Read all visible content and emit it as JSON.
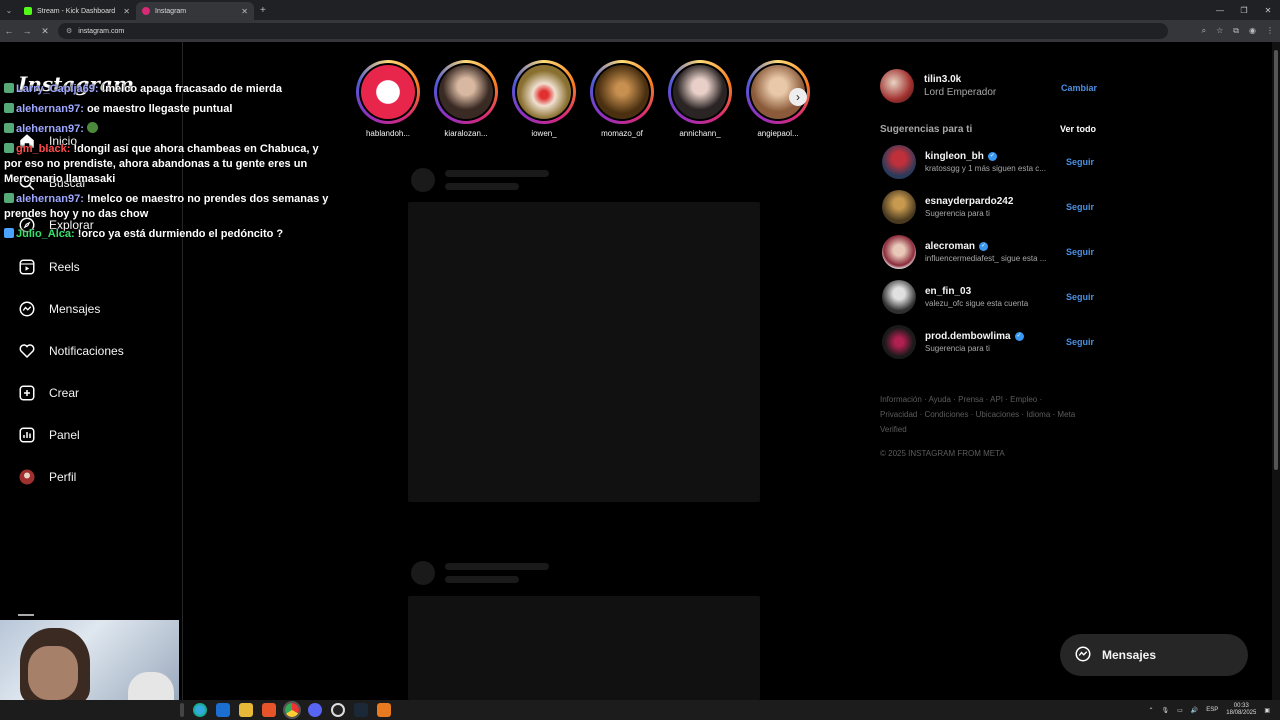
{
  "browser": {
    "tabs": [
      {
        "title": "Stream - Kick Dashboard",
        "favicon_color": "#53fc18"
      },
      {
        "title": "Instagram",
        "favicon_color": "#d62976"
      }
    ],
    "url": "instagram.com"
  },
  "sidebar": {
    "logo": "Instagram",
    "items": [
      {
        "label": "Inicio",
        "icon": "home-icon"
      },
      {
        "label": "Buscar",
        "icon": "search-icon"
      },
      {
        "label": "Explorar",
        "icon": "compass-icon"
      },
      {
        "label": "Reels",
        "icon": "reels-icon"
      },
      {
        "label": "Mensajes",
        "icon": "messenger-icon"
      },
      {
        "label": "Notificaciones",
        "icon": "heart-icon"
      },
      {
        "label": "Crear",
        "icon": "plus-square-icon"
      },
      {
        "label": "Panel",
        "icon": "chart-icon"
      },
      {
        "label": "Perfil",
        "icon": "avatar-icon"
      }
    ]
  },
  "chat": [
    {
      "user": "Larry_Capija69:",
      "text": "!melco apaga fracasado de mierda",
      "color_class": "u1"
    },
    {
      "user": "alehernan97:",
      "text": "oe maestro llegaste puntual",
      "color_class": "u1"
    },
    {
      "user": "alehernan97:",
      "text": "",
      "color_class": "u1"
    },
    {
      "user": "gm_black:",
      "text": "!dongil así que ahora chambeas en Chabuca, y por eso no prendiste, ahora abandonas a tu gente eres un Mercenario llamasaki",
      "color_class": "u2"
    },
    {
      "user": "alehernan97:",
      "text": "!melco oe maestro no prendes dos semanas y prendes hoy y no das chow",
      "color_class": "u1"
    },
    {
      "user": "Julio_Alca:",
      "text": "!orco ya está durmiendo el pedóncito ?",
      "color_class": "u3"
    }
  ],
  "stories": [
    {
      "name": "hablandoh...",
      "color": "#e8254a"
    },
    {
      "name": "kiaralozan...",
      "color": "#6b4a3c"
    },
    {
      "name": "iowen_",
      "color": "#c8b060"
    },
    {
      "name": "momazo_of",
      "color": "#8a6a30"
    },
    {
      "name": "annichann_",
      "color": "#3a3030"
    },
    {
      "name": "angiepaol...",
      "color": "#c09070"
    }
  ],
  "profile": {
    "username": "tilin3.0k",
    "fullname": "Lord Emperador",
    "switch_label": "Cambiar"
  },
  "suggestions": {
    "heading": "Sugerencias para ti",
    "see_all": "Ver todo",
    "follow_label": "Seguir",
    "items": [
      {
        "name": "kingleon_bh",
        "sub": "kratossgg y 1 más siguen esta c...",
        "verified": true,
        "color": "#c0303a"
      },
      {
        "name": "esnayderpardo242",
        "sub": "Sugerencia para ti",
        "verified": false,
        "color": "#8a6a30"
      },
      {
        "name": "alecroman",
        "sub": "influencermediafest_ sigue esta ...",
        "verified": true,
        "color": "#e0c0b0"
      },
      {
        "name": "en_fin_03",
        "sub": "valezu_ofc sigue esta cuenta",
        "verified": false,
        "color": "#d0d0d0"
      },
      {
        "name": "prod.dembowlima",
        "sub": "Sugerencia para ti",
        "verified": true,
        "color": "#b02050"
      }
    ]
  },
  "footer": {
    "links": "Información · Ayuda · Prensa · API · Empleo · Privacidad · Condiciones · Ubicaciones · Idioma · Meta Verified",
    "copyright": "© 2025 INSTAGRAM FROM META"
  },
  "messages_button": "Mensajes",
  "taskbar": {
    "lang": "ESP",
    "time": "00:33",
    "date": "18/08/2025"
  }
}
